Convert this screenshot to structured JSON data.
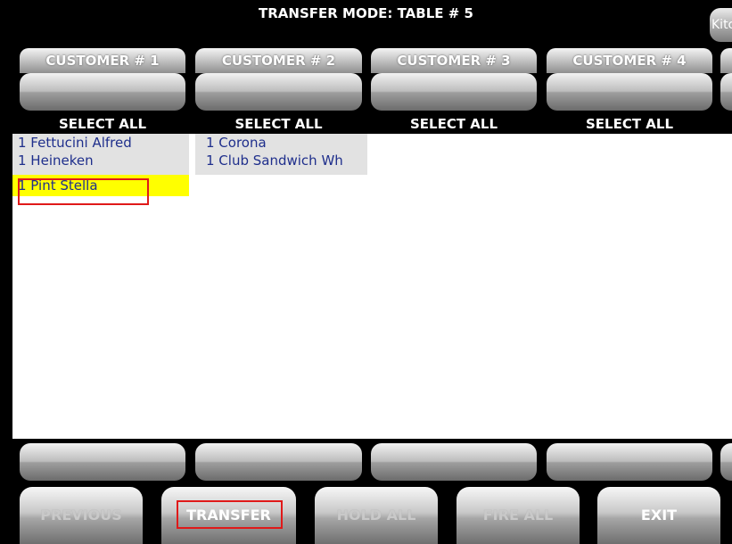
{
  "title": "TRANSFER MODE: TABLE # 5",
  "kitchen_button": "Kitc",
  "customers": [
    {
      "label": "CUSTOMER # 1",
      "select_all": "SELECT ALL",
      "items": [
        "1 Fettucini Alfred",
        "1 Heineken",
        "1 Pint Stella"
      ]
    },
    {
      "label": "CUSTOMER # 2",
      "select_all": "SELECT ALL",
      "items": [
        "1 Corona",
        "1 Club Sandwich Wh"
      ]
    },
    {
      "label": "CUSTOMER # 3",
      "select_all": "SELECT ALL",
      "items": []
    },
    {
      "label": "CUSTOMER # 4",
      "select_all": "SELECT ALL",
      "items": []
    }
  ],
  "highlighted_item": "1 Pint Stella",
  "bottom_buttons": {
    "previous": "PREVIOUS",
    "transfer": "TRANSFER",
    "hold_all": "HOLD ALL",
    "fire_all": "FIRE ALL",
    "exit": "EXIT"
  },
  "colors": {
    "background": "#000000",
    "item_text": "#1f2f8c",
    "highlight": "#ffff00",
    "annotation": "#e01919"
  }
}
